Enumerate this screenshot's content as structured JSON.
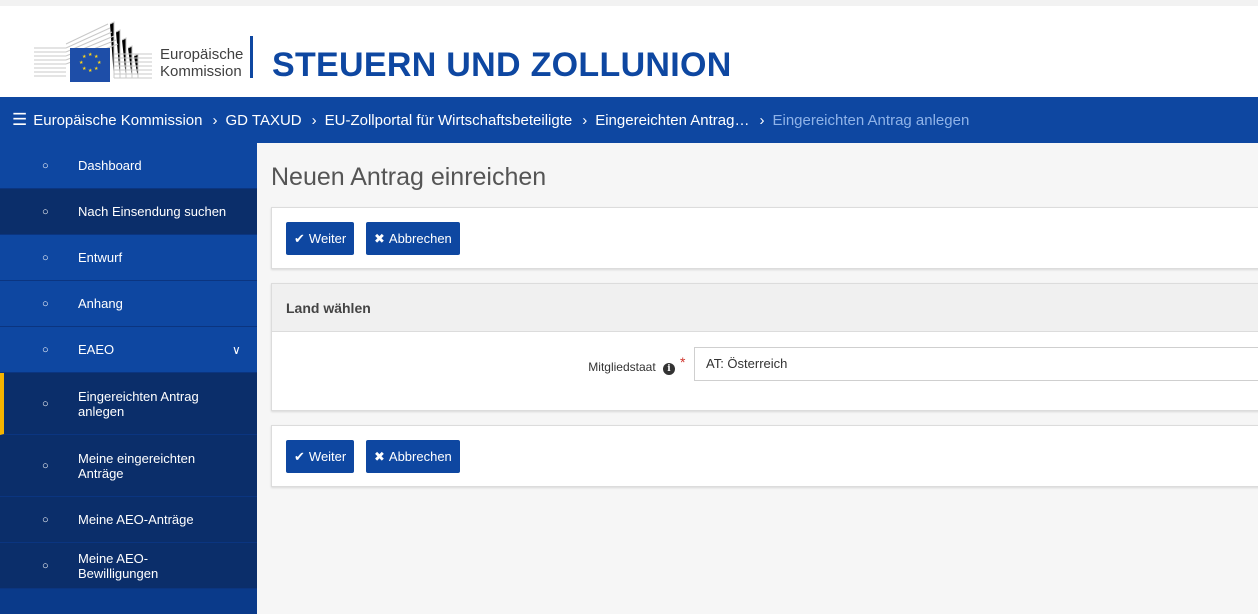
{
  "header": {
    "logo_line1": "Europäische",
    "logo_line2": "Kommission",
    "site_title": "STEUERN UND ZOLLUNION"
  },
  "breadcrumb": {
    "items": [
      "Europäische Kommission",
      "GD TAXUD",
      "EU-Zollportal für Wirtschaftsbeteiligte",
      "Eingereichten Antrag…"
    ],
    "current": "Eingereichten Antrag anlegen"
  },
  "sidebar": {
    "items": [
      {
        "label": "Dashboard"
      },
      {
        "label": "Nach Einsendung suchen"
      },
      {
        "label": "Entwurf"
      },
      {
        "label": "Anhang"
      },
      {
        "label": "EAEO"
      },
      {
        "label": "Eingereichten Antrag anlegen"
      },
      {
        "label": "Meine eingereichten Anträge"
      },
      {
        "label": "Meine AEO-Anträge"
      },
      {
        "label": "Meine AEO-Bewilligungen"
      }
    ]
  },
  "main": {
    "page_title": "Neuen Antrag einreichen",
    "buttons": {
      "continue": "Weiter",
      "cancel": "Abbrechen"
    },
    "section_title": "Land wählen",
    "field_label": "Mitgliedstaat",
    "field_required": "*",
    "field_value": "AT: Österreich"
  },
  "colors": {
    "brand": "#0e47a1",
    "active_indicator": "#f5b400",
    "required": "#d0342c"
  }
}
